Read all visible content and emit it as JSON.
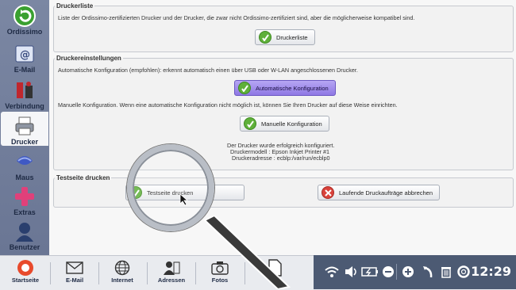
{
  "sidebar": {
    "items": [
      {
        "label": "Ordissimo",
        "icon": "ordissimo-back-icon"
      },
      {
        "label": "E-Mail",
        "icon": "email-icon"
      },
      {
        "label": "Verbindung",
        "icon": "connection-icon"
      },
      {
        "label": "Drucker",
        "icon": "printer-icon",
        "active": true
      },
      {
        "label": "Maus",
        "icon": "mouse-icon"
      },
      {
        "label": "Extras",
        "icon": "plus-icon"
      },
      {
        "label": "Benutzer",
        "icon": "user-icon"
      }
    ]
  },
  "printer_list": {
    "legend": "Druckerliste",
    "description": "Liste der Ordissimo-zertifizierten Drucker und der Drucker, die zwar nicht Ordissimo-zertifiziert sind, aber die möglicherweise kompatibel sind.",
    "button": "Druckerliste"
  },
  "settings": {
    "legend": "Druckereinstellungen",
    "auto_text": "Automatische Konfiguration (empfohlen): erkennt automatisch einen über USB oder W-LAN angeschlossenen Drucker.",
    "auto_button": "Automatische Konfiguration",
    "manual_text": "Manuelle Konfiguration. Wenn eine automatische Konfiguration nicht möglich ist, können Sie Ihren Drucker auf diese Weise einrichten.",
    "manual_button": "Manuelle Konfiguration",
    "status_line1": "Der Drucker wurde erfolgreich konfiguriert.",
    "status_line2": "Druckermodell : Epson Inkjet Printer #1",
    "status_line3": "Druckeradresse : ecblp:/var/run/ecblp0"
  },
  "test": {
    "legend": "Testseite drucken",
    "print_button": "Testseite drucken",
    "cancel_button": "Laufende Druckaufträge abbrechen"
  },
  "taskbar": {
    "items": [
      {
        "label": "Startseite",
        "icon": "home-icon"
      },
      {
        "label": "E-Mail",
        "icon": "envelope-icon"
      },
      {
        "label": "Internet",
        "icon": "globe-icon"
      },
      {
        "label": "Adressen",
        "icon": "contacts-icon"
      },
      {
        "label": "Fotos",
        "icon": "camera-icon"
      }
    ],
    "clock": "12:29"
  },
  "colors": {
    "primary_button": "#9b86ea",
    "tray": "#4c5a73",
    "sidebar": "#727e9c"
  }
}
